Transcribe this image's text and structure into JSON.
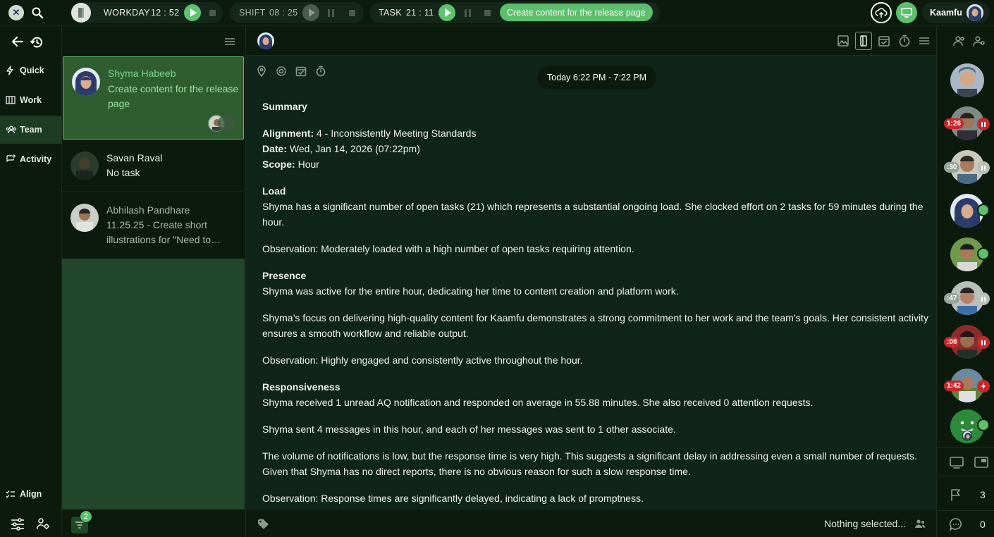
{
  "topbar": {
    "workday_label": "WORKDAY",
    "workday_time": "12 : 52",
    "shift_label": "SHIFT",
    "shift_time": "08 : 25",
    "task_label": "TASK",
    "task_time": "21 : 11",
    "current_task": "Create content for the release page",
    "user_name": "Kaamfu"
  },
  "nav": {
    "items": [
      {
        "label": "Quick",
        "icon": "bolt-icon"
      },
      {
        "label": "Work",
        "icon": "board-icon"
      },
      {
        "label": "Team",
        "icon": "team-icon"
      },
      {
        "label": "Activity",
        "icon": "activity-icon"
      }
    ],
    "align_label": "Align"
  },
  "list": {
    "cards": [
      {
        "name": "Shyma Habeeb",
        "desc": "Create content for the release page",
        "selected": true
      },
      {
        "name": "Savan Raval",
        "desc": "No task"
      },
      {
        "name": "Abhilash Pandhare",
        "desc": "11.25.25 - Create short illustrations for \"Need to…"
      }
    ],
    "filter_count": "2"
  },
  "main": {
    "time_range": "Today 6:22 PM - 7:22 PM",
    "summary_title": "Summary",
    "alignment_label": "Alignment:",
    "alignment_value": "4 - Inconsistently Meeting Standards",
    "date_label": "Date:",
    "date_value": "Wed, Jan 14, 2026 (07:22pm)",
    "scope_label": "Scope:",
    "scope_value": "Hour",
    "load_title": "Load",
    "load_text": "Shyma has a significant number of open tasks (21) which represents a substantial ongoing load. She clocked effort on 2 tasks for 59 minutes during the hour.",
    "load_obs": "Observation: Moderately loaded with a high number of open tasks requiring attention.",
    "presence_title": "Presence",
    "presence_text": "Shyma was active for the entire hour, dedicating her time to content creation and platform work.",
    "presence_text2": "Shyma’s focus on delivering high-quality content for Kaamfu demonstrates a strong commitment to her work and the team’s goals. Her consistent activity ensures a smooth workflow and reliable output.",
    "presence_obs": "Observation: Highly engaged and consistently active throughout the hour.",
    "resp_title": "Responsiveness",
    "resp_text": "Shyma received 1 unread AQ notification and responded on average in 55.88 minutes. She also received 0 attention requests.",
    "resp_text2": "Shyma sent 4 messages in this hour, and each of her messages was sent to 1 other associate.",
    "resp_text3": "The volume of notifications is low, but the response time is very high. This suggests a significant delay in addressing even a small number of requests. Given that Shyma has no direct reports, there is no obvious reason for such a slow response time.",
    "resp_obs": "Observation: Response times are significantly delayed, indicating a lack of promptness.",
    "nothing_selected": "Nothing selected..."
  },
  "right": {
    "people": [
      {
        "badge": "",
        "status": ""
      },
      {
        "badge": "1:26",
        "status": "paused-red"
      },
      {
        "badge": ":30",
        "status": "paused-gray"
      },
      {
        "badge": "",
        "status": "online"
      },
      {
        "badge": "",
        "status": "online"
      },
      {
        "badge": ":47",
        "status": "paused-gray"
      },
      {
        "badge": ":08",
        "status": "paused-red"
      },
      {
        "badge": "1:42",
        "status": "alert-red"
      },
      {
        "badge": "",
        "status": "online"
      }
    ],
    "flag_count": "3",
    "comment_count": "0"
  },
  "colors": {
    "accent_green": "#5cbf6c",
    "selected_card": "#2f5d2f",
    "alert_red": "#c6282c"
  }
}
